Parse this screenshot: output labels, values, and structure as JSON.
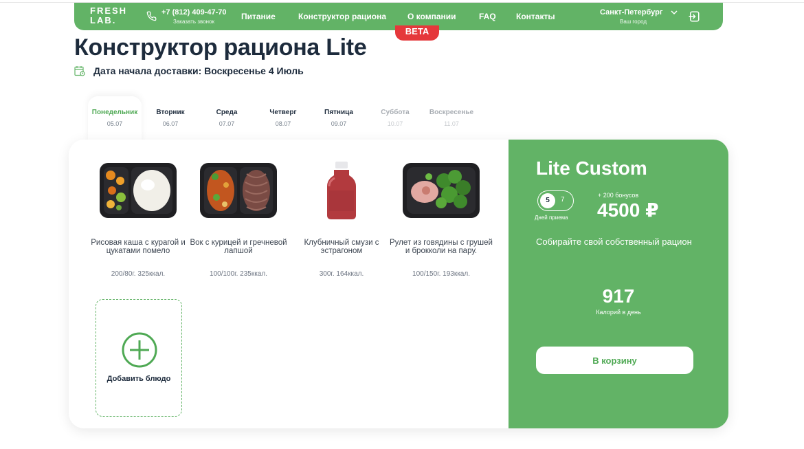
{
  "header": {
    "logo": "FRESH LAB.",
    "phone": "+7 (812) 409-47-70",
    "phone_sub": "Заказать звонок",
    "nav": [
      "Питание",
      "Конструктор рациона",
      "О компании",
      "FAQ",
      "Контакты"
    ],
    "city": "Санкт-Петербург",
    "city_sub": "Ваш город",
    "accent": "#62b366"
  },
  "beta_badge": "BETA",
  "page_title": "Конструктор рациона Lite",
  "delivery": "Дата начала доставки: Воскресенье 4 Июль",
  "days": [
    {
      "name": "Понедельник",
      "date": "05.07",
      "state": "active"
    },
    {
      "name": "Вторник",
      "date": "06.07",
      "state": "normal"
    },
    {
      "name": "Среда",
      "date": "07.07",
      "state": "normal"
    },
    {
      "name": "Четверг",
      "date": "08.07",
      "state": "normal"
    },
    {
      "name": "Пятница",
      "date": "09.07",
      "state": "normal"
    },
    {
      "name": "Суббота",
      "date": "10.07",
      "state": "disabled"
    },
    {
      "name": "Воскресенье",
      "date": "11.07",
      "state": "disabled"
    }
  ],
  "dishes": [
    {
      "name": "Рисовая каша с курагой и цукатами помело",
      "meta": "200/80г. 325ккал.",
      "icon": "rice-porridge-container"
    },
    {
      "name": "Вок с курицей и гречневой лапшой",
      "meta": "100/100г. 235ккал.",
      "icon": "wok-noodles-container"
    },
    {
      "name": "Клубничный смузи с эстрагоном",
      "meta": "300г. 164ккал.",
      "icon": "smoothie-bottle"
    },
    {
      "name": "Рулет из говядины с грушей и брокколи на пару.",
      "meta": "100/150г. 193ккал.",
      "icon": "beef-roll-broccoli-container"
    }
  ],
  "add_dish": "Добавить блюдо",
  "summary": {
    "plan": "Lite Custom",
    "days_selected": "5",
    "days_alt": "7",
    "days_caption": "Дней приема",
    "bonus": "+ 200 бонусов",
    "price": "4500 ₽",
    "description": "Собирайте свой собственный рацион",
    "calories": "917",
    "calories_caption": "Калорий в день",
    "cart_button": "В корзину"
  }
}
